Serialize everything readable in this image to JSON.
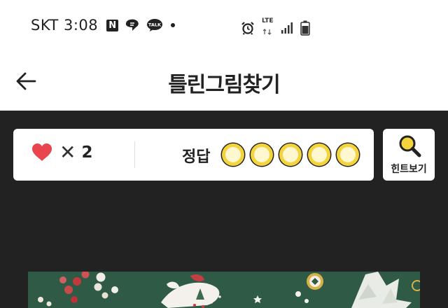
{
  "status_bar": {
    "carrier_time": "SKT 3:08",
    "notification_n": "N",
    "talk_badge": "TALK",
    "network": "LTE",
    "icons": [
      "n-icon",
      "chat-icon",
      "kakaotalk-icon",
      "dot-icon",
      "alarm-icon",
      "lte-icon",
      "signal-icon",
      "battery-icon"
    ]
  },
  "header": {
    "title": "틀린그림찾기",
    "back_icon": "arrow-left-icon"
  },
  "game_status": {
    "lives_icon": "heart-icon",
    "lives_multiplier": "✕",
    "lives_count": "2",
    "answer_label": "정답",
    "answer_total": 5,
    "answer_found": 0
  },
  "hint": {
    "label": "힌트보기",
    "icon": "magnifier-icon"
  },
  "colors": {
    "background": "#222222",
    "heart": "#e8454f",
    "slot_ring": "#f3d43c",
    "slot_fill": "#fff7cf",
    "puzzle_bg": "#2f5a46"
  }
}
